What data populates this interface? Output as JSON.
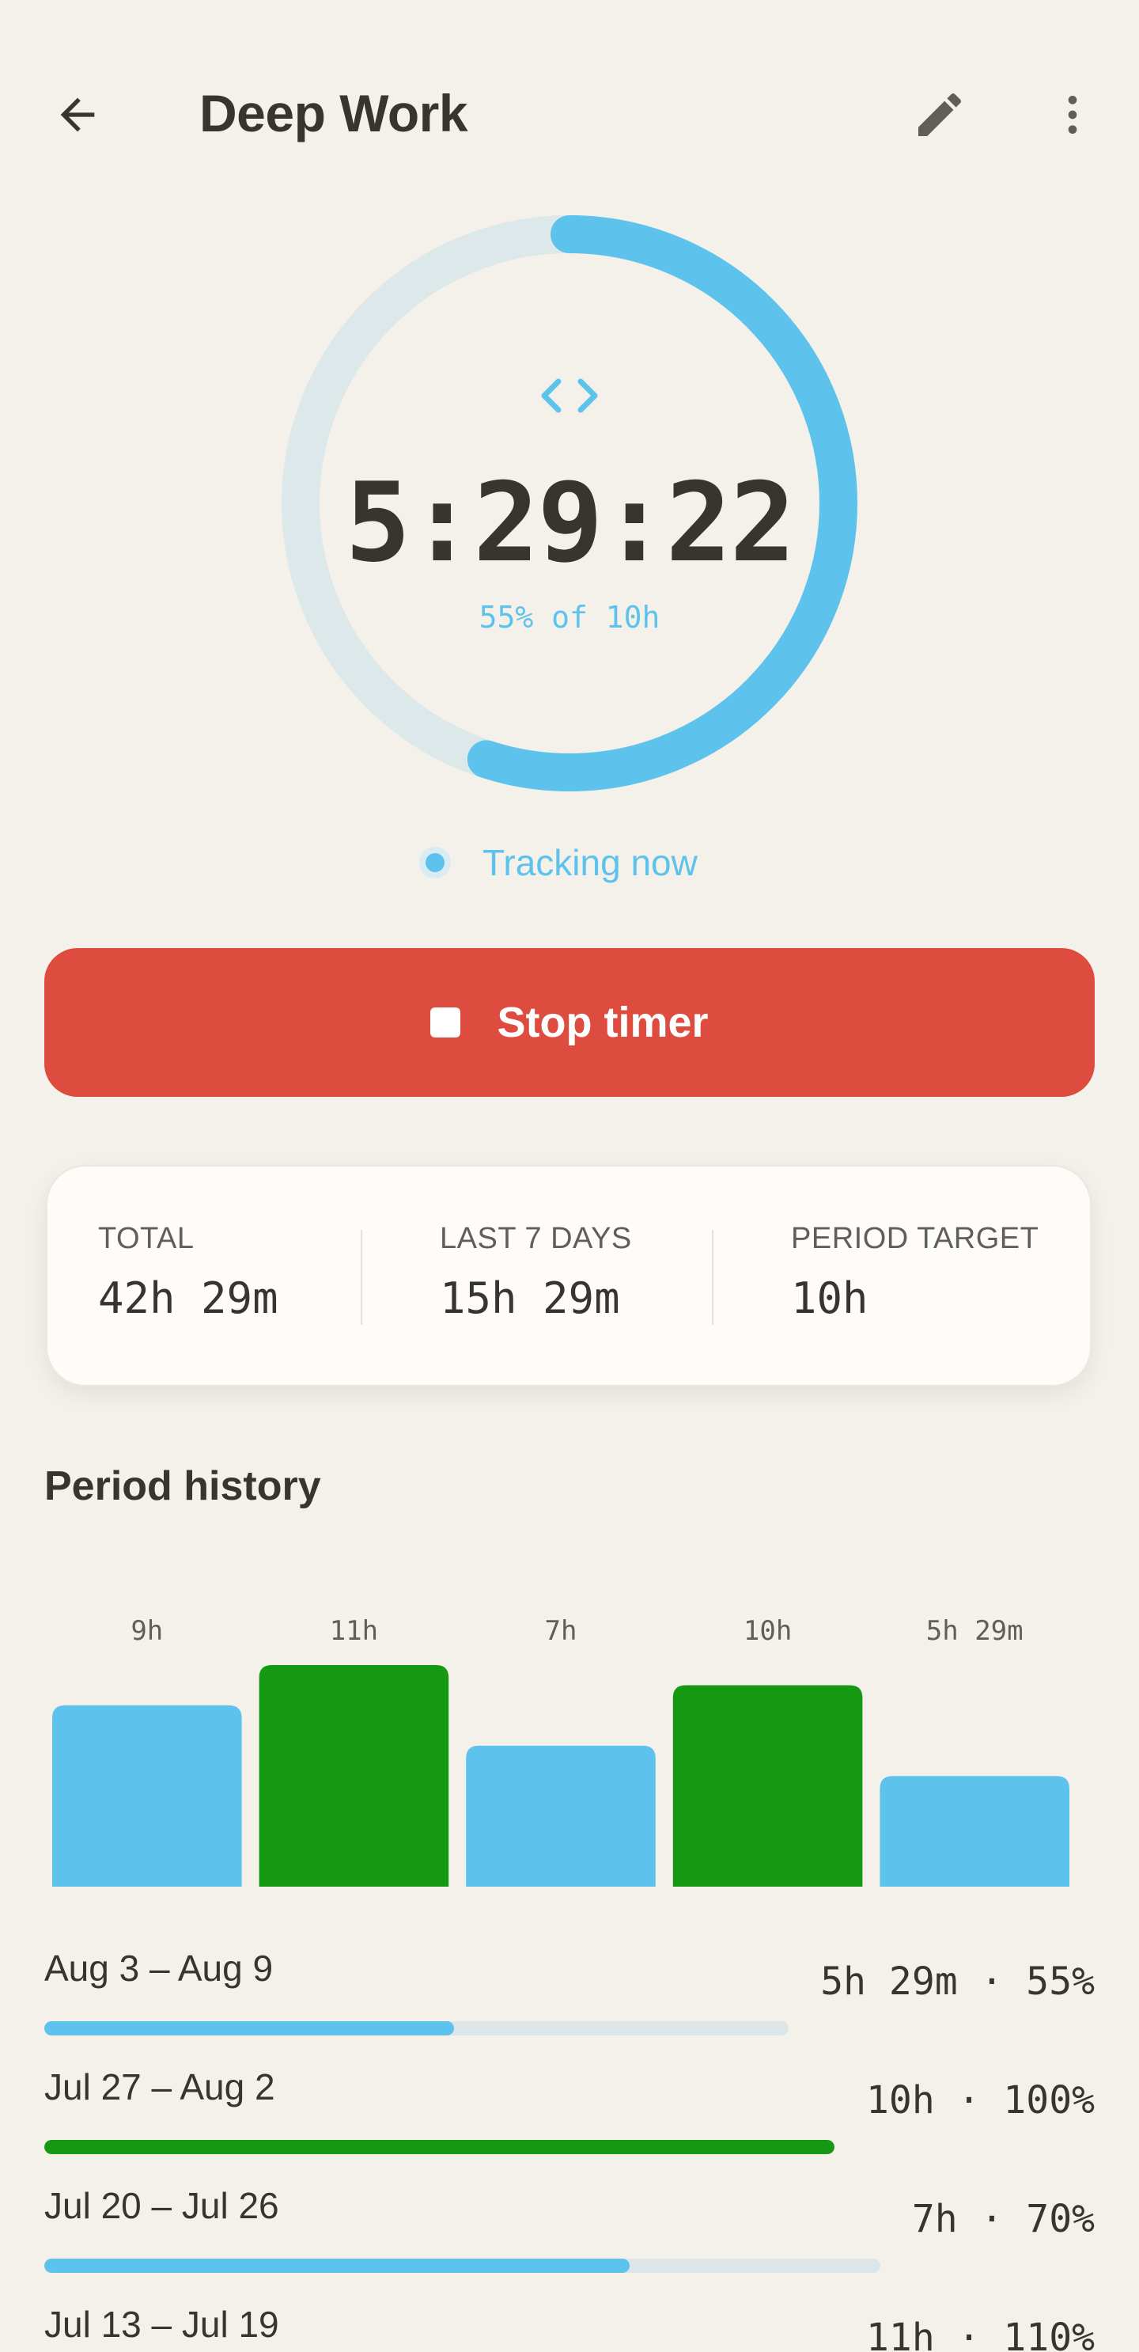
{
  "appbar": {
    "title": "Deep Work"
  },
  "timer": {
    "value": "5:29:22",
    "progress_text": "55% of 10h",
    "progress": 0.55,
    "accent": "#5ec3ec",
    "track_color": "#dce8ea"
  },
  "status": {
    "label": "Tracking now"
  },
  "stop_button": {
    "label": "Stop timer",
    "color": "#dd4c3f"
  },
  "stats": [
    {
      "label": "TOTAL",
      "value": "42h 29m"
    },
    {
      "label": "LAST 7 DAYS",
      "value": "15h 29m"
    },
    {
      "label": "PERIOD TARGET",
      "value": "10h"
    }
  ],
  "history_title": "Period history",
  "chart_data": {
    "type": "bar",
    "categories": [
      "",
      "",
      "",
      "",
      ""
    ],
    "values": [
      9,
      11,
      7,
      10,
      5.49
    ],
    "data_labels": [
      "9h",
      "11h",
      "7h",
      "10h",
      "5h 29m"
    ],
    "colors": [
      "#5ec3ec",
      "#159812",
      "#5ec3ec",
      "#159812",
      "#5ec3ec"
    ],
    "ylim": [
      0,
      11
    ],
    "target": 10,
    "title": "",
    "xlabel": "",
    "ylabel": ""
  },
  "history": [
    {
      "range": "Aug 3 – Aug 9",
      "value": "5h 29m · 55%",
      "fraction": 0.55,
      "color": "#5ec3ec"
    },
    {
      "range": "Jul 27 – Aug 2",
      "value": "10h · 100%",
      "fraction": 1.0,
      "color": "#159812"
    },
    {
      "range": "Jul 20 – Jul 26",
      "value": "7h · 70%",
      "fraction": 0.7,
      "color": "#5ec3ec"
    },
    {
      "range": "Jul 13 – Jul 19",
      "value": "11h · 110%",
      "fraction": 1.0,
      "color": "#159812"
    }
  ]
}
